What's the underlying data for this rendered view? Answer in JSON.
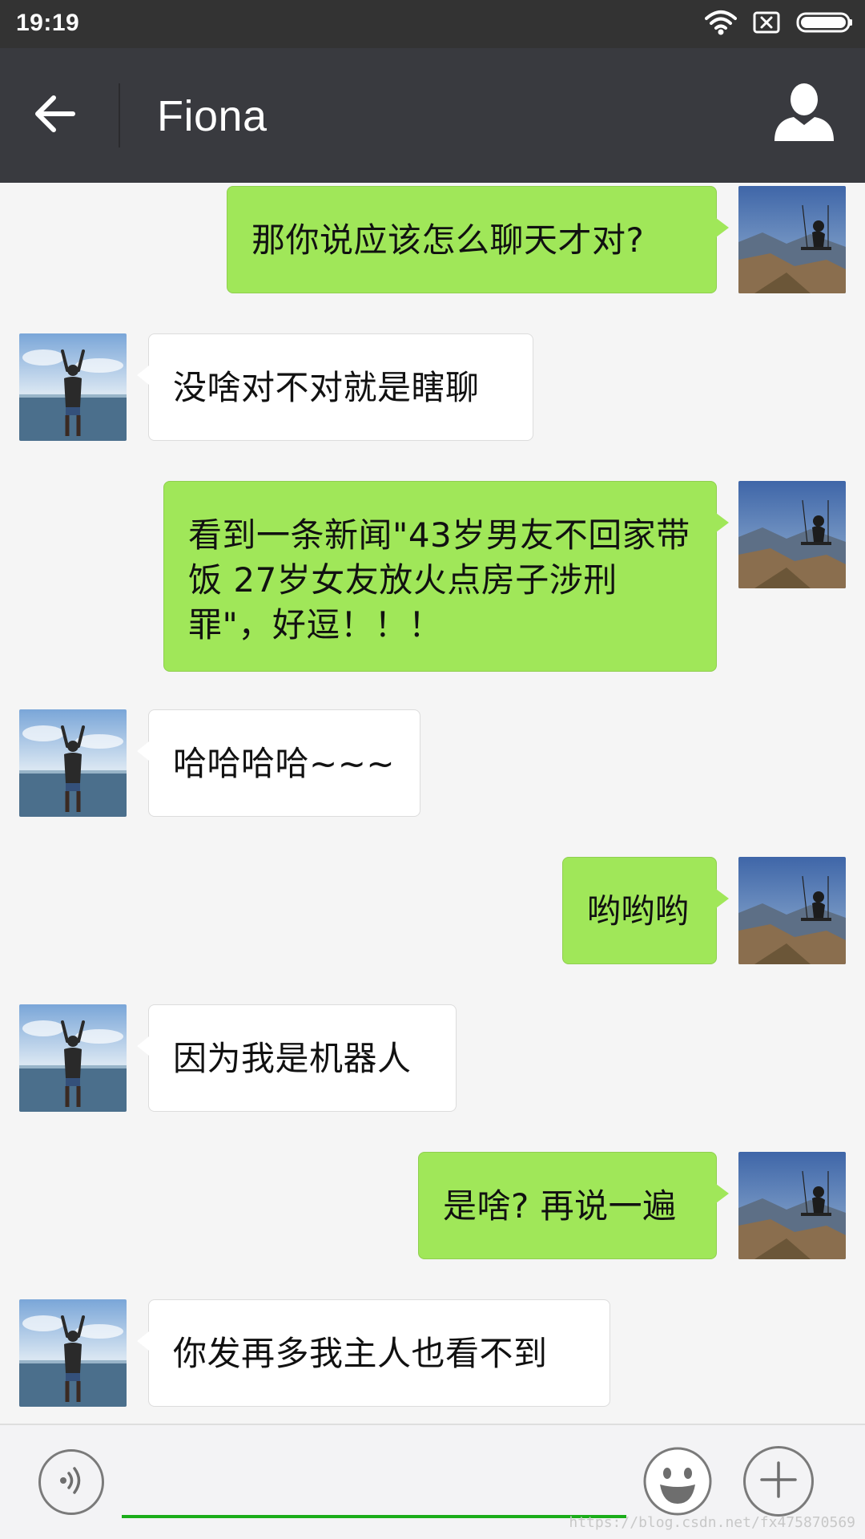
{
  "status_bar": {
    "time": "19:19",
    "icons": [
      "wifi-icon",
      "no-sim-icon",
      "battery-icon"
    ]
  },
  "header": {
    "title": "Fiona",
    "back_icon": "arrow-left-icon",
    "profile_icon": "person-icon"
  },
  "messages": [
    {
      "side": "right",
      "text": "那你说应该怎么聊天才对?"
    },
    {
      "side": "left",
      "text": "没啥对不对就是瞎聊"
    },
    {
      "side": "right",
      "text": "看到一条新闻\"43岁男友不回家带饭 27岁女友放火点房子涉刑罪\"，好逗！！！"
    },
    {
      "side": "left",
      "text": "哈哈哈哈~~~"
    },
    {
      "side": "right",
      "text": "哟哟哟"
    },
    {
      "side": "left",
      "text": "因为我是机器人"
    },
    {
      "side": "right",
      "text": "是啥? 再说一遍"
    },
    {
      "side": "left",
      "text": "你发再多我主人也看不到"
    }
  ],
  "input_bar": {
    "input_value": "",
    "icons": [
      "voice-icon",
      "emoji-icon",
      "plus-icon"
    ]
  },
  "watermark": "https://blog.csdn.net/fx475870569",
  "colors": {
    "status_bar": "#333333",
    "header": "#393a3f",
    "chat_background": "#f5f5f5",
    "sent_bubble": "#a0e759",
    "received_bubble": "#ffffff",
    "input_underline": "#1aad19"
  }
}
